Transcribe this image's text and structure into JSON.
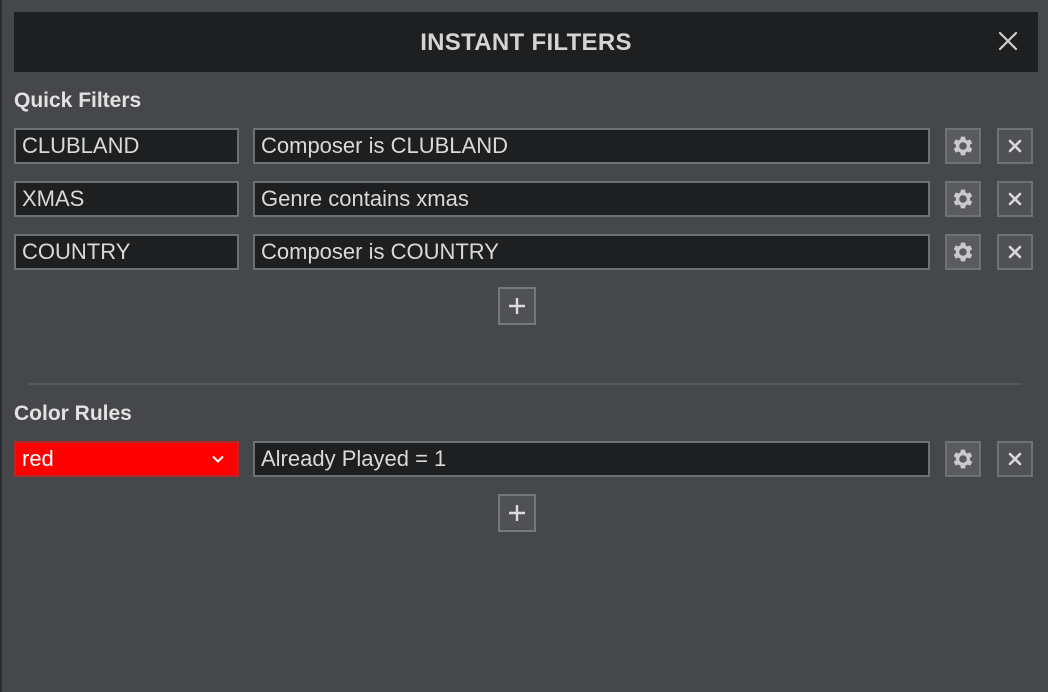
{
  "dialog": {
    "title": "INSTANT FILTERS",
    "close_icon": "close-icon"
  },
  "quick_filters": {
    "label": "Quick Filters",
    "items": [
      {
        "name": "CLUBLAND",
        "rule": "Composer is CLUBLAND"
      },
      {
        "name": "XMAS",
        "rule": "Genre contains xmas"
      },
      {
        "name": "COUNTRY",
        "rule": "Composer is COUNTRY"
      }
    ],
    "add_icon": "plus-icon"
  },
  "color_rules": {
    "label": "Color Rules",
    "items": [
      {
        "color": "red",
        "color_hex": "#ff0000",
        "rule": "Already Played = 1"
      }
    ],
    "add_icon": "plus-icon"
  },
  "icons": {
    "settings": "gear-icon",
    "remove": "close-icon",
    "dropdown": "chevron-down-icon"
  }
}
